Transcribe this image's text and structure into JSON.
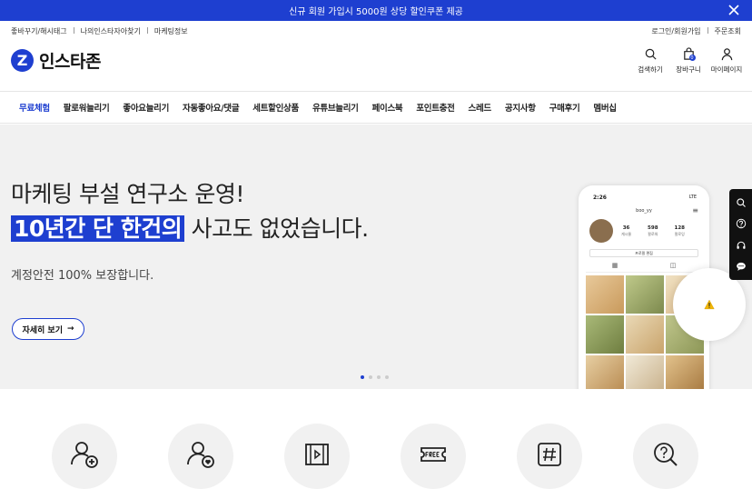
{
  "promo": {
    "text": "신규 회원 가입시 5000원 상당 할인쿠폰 제공"
  },
  "util": {
    "left": [
      "좋바꾸기/해시태그",
      "나의인스타자아찾기",
      "마케팅정보"
    ],
    "right": [
      "로그인/회원가입",
      "주문조회"
    ]
  },
  "logo": {
    "mark": "Z",
    "name": "인스타존"
  },
  "header_icons": [
    {
      "label": "검색하기",
      "icon": "search-icon"
    },
    {
      "label": "장바구니",
      "icon": "cart-icon",
      "badge": "0"
    },
    {
      "label": "마이페이지",
      "icon": "user-icon"
    }
  ],
  "nav": [
    "무료체험",
    "팔로워늘리기",
    "좋아요늘리기",
    "자동좋아요/댓글",
    "세트할인상품",
    "유튜브늘리기",
    "페이스북",
    "포인트충전",
    "스레드",
    "공지사항",
    "구매후기",
    "멤버십"
  ],
  "hero": {
    "line1": "마케팅 부설 연구소 운영!",
    "line2_highlight": "10년간 단 한건의",
    "line2_rest": " 사고도 없었습니다.",
    "sub": "계정안전 100% 보장합니다.",
    "cta": "자세히 보기",
    "cta_arrow": "→",
    "slides": 4,
    "active_slide": 1
  },
  "phone": {
    "time": "2:26",
    "signal": "LTE",
    "username": "boo_yy",
    "stats": [
      {
        "n": "36",
        "t": "게시물"
      },
      {
        "n": "598",
        "t": "팔로워"
      },
      {
        "n": "128",
        "t": "팔로잉"
      }
    ],
    "edit": "프로필 편집",
    "tabs": [
      "▦",
      "◫"
    ]
  },
  "colors": {
    "brand": "#1e3fd0",
    "hero_bg": "#f1f1f1"
  }
}
